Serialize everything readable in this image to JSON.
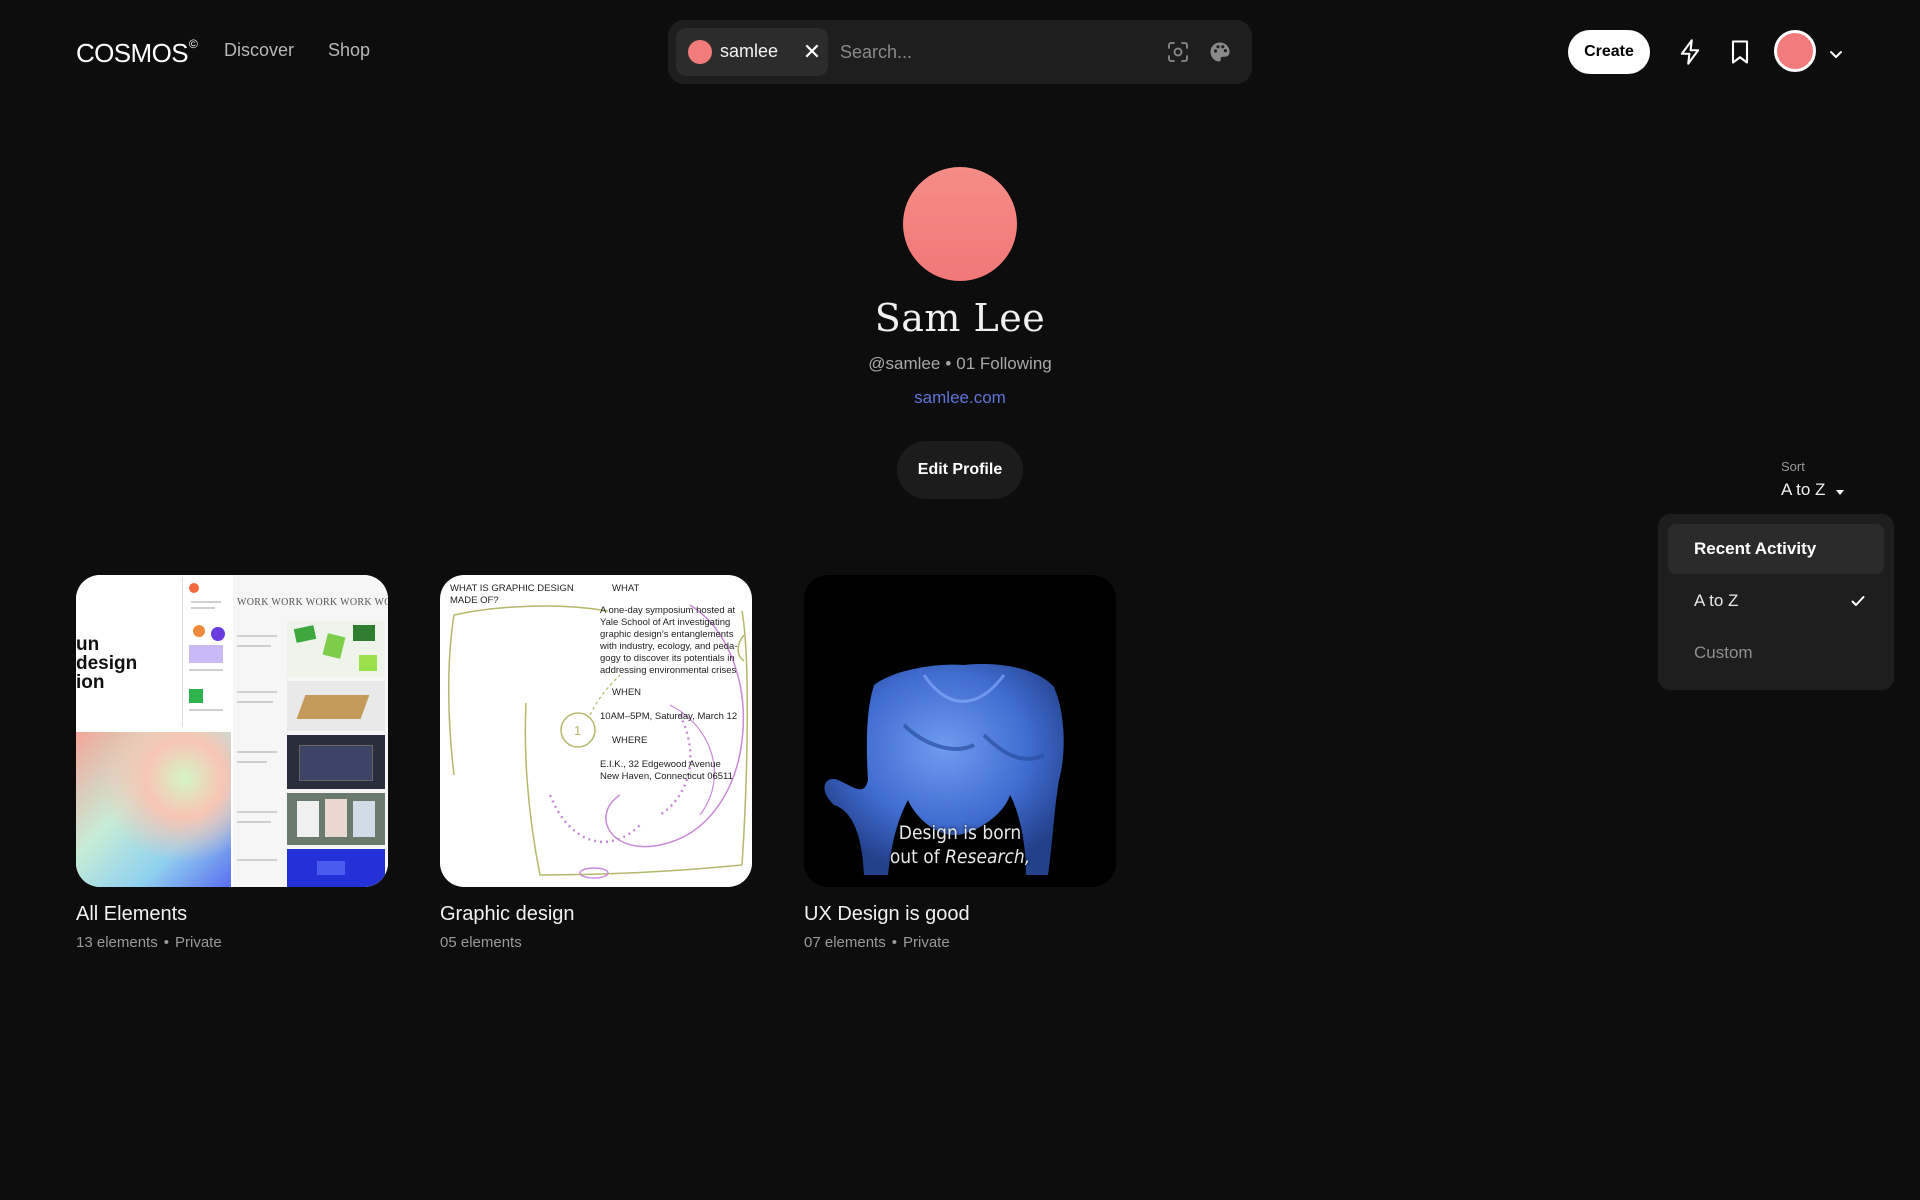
{
  "header": {
    "logo": "COSMOS",
    "logo_mark": "©",
    "nav": {
      "discover": "Discover",
      "shop": "Shop"
    },
    "search": {
      "chip_label": "samlee",
      "chip_close": "✕",
      "placeholder": "Search...",
      "value": ""
    },
    "create_label": "Create",
    "icons": [
      "bolt-icon",
      "bookmark-icon",
      "chevron-down-icon",
      "scan-icon",
      "palette-icon"
    ]
  },
  "profile": {
    "name": "Sam Lee",
    "handle": "@samlee",
    "separator": "•",
    "following": "01 Following",
    "website": "samlee.com",
    "edit_label": "Edit Profile",
    "avatar_color": "#f27c7c"
  },
  "sort": {
    "label": "Sort",
    "value": "A to Z",
    "options": [
      "Recent Activity",
      "A to Z",
      "Custom"
    ],
    "selected": "A to Z"
  },
  "collections": [
    {
      "title": "All Elements",
      "count": "13 elements",
      "visibility": "Private",
      "separator": "•"
    },
    {
      "title": "Graphic design",
      "count": "05 elements",
      "visibility": ""
    },
    {
      "title": "UX Design is good",
      "count": "07 elements",
      "visibility": "Private",
      "separator": "•"
    }
  ],
  "thumb_text": {
    "collage_big": "un\ndesign\nion",
    "collage_work": "WORK WORK WORK WORK WORK",
    "poster_q": "WHAT IS GRAPHIC DESIGN\nMADE OF?",
    "poster_what": "WHAT",
    "poster_desc": "A one-day symposium hosted at\nYale School of Art investigating\ngraphic design’s entanglements\nwith industry, ecology, and peda-\ngogy to discover its potentials in\naddressing environmental crises",
    "poster_when": "WHEN",
    "poster_time": "10AM–5PM, Saturday, March 12",
    "poster_where": "WHERE",
    "poster_addr": "E.I.K., 32 Edgewood Avenue\nNew Haven, Connecticut 06511",
    "video_caption_1": "Design is born",
    "video_caption_2a": "out of ",
    "video_caption_2b": "Research,"
  },
  "colors": {
    "background": "#0d0d0d",
    "accent_link": "#5f74d8",
    "avatar": "#f27c7c"
  }
}
